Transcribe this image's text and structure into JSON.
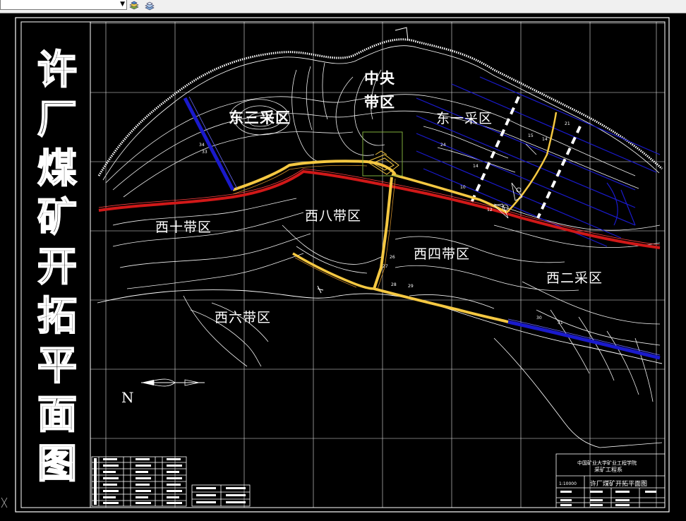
{
  "app": {
    "layer_dropdown_value": "",
    "toolbar_icons": [
      "layer-properties-icon",
      "layer-states-icon"
    ]
  },
  "drawing": {
    "title_chars": [
      "许",
      "厂",
      "煤",
      "矿",
      "开",
      "拓",
      "平",
      "面",
      "图"
    ],
    "zones": {
      "east_three": "东三采区",
      "central_line1": "中央",
      "central_line2": "带区",
      "east_one": "东一采区",
      "west_ten": "西十带区",
      "west_eight": "西八带区",
      "west_four": "西四带区",
      "west_two": "西二采区",
      "west_six": "西六带区"
    },
    "north_label": "N",
    "colors": {
      "background": "#000000",
      "contour": "#ffffff",
      "roadway_yellow": "#f5c842",
      "roadway_red": "#d01818",
      "roadway_blue": "#1a1acc",
      "grid": "#ffffff"
    }
  },
  "title_block": {
    "institution": "中国矿业大学矿业工程学院",
    "department": "采矿工程系",
    "drawing_name": "许厂煤矿开拓平面图",
    "scale": "1:10000"
  }
}
